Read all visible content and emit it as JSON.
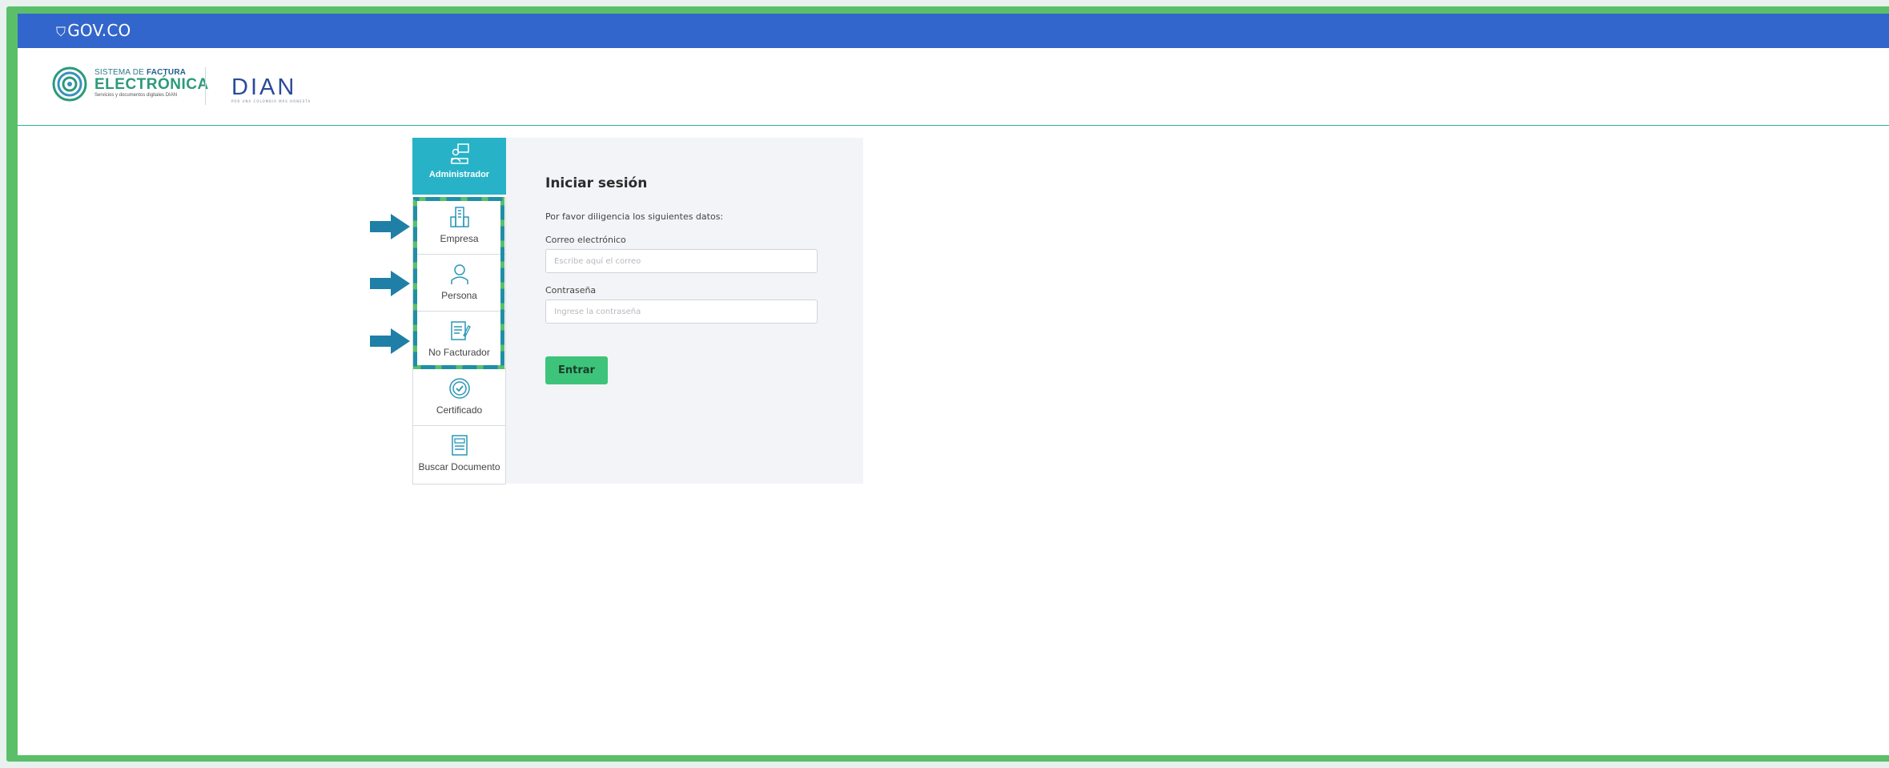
{
  "header": {
    "gov_label": "GOV.CO"
  },
  "brand": {
    "sfe_line1_a": "SISTEMA DE ",
    "sfe_line1_b": "FACTURA",
    "sfe_line2": "ELECTRÓNICA",
    "sfe_line3": "Servicios y documentos digitales DIAN",
    "dian_word": "DIAN",
    "dian_sub": "POR UNA COLOMBIA MÁS HONESTA"
  },
  "sidebar": {
    "items": [
      {
        "label": "Administrador",
        "icon": "admin-icon",
        "active": true
      },
      {
        "label": "Empresa",
        "icon": "building-icon",
        "active": false
      },
      {
        "label": "Persona",
        "icon": "person-icon",
        "active": false
      },
      {
        "label": "No Facturador",
        "icon": "document-edit-icon",
        "active": false
      },
      {
        "label": "Certificado",
        "icon": "certificate-icon",
        "active": false
      },
      {
        "label": "Buscar Documento",
        "icon": "search-document-icon",
        "active": false
      }
    ]
  },
  "login": {
    "title": "Iniciar sesión",
    "instruction": "Por favor diligencia los siguientes datos:",
    "email_label": "Correo electrónico",
    "email_placeholder": "Escribe aquí el correo",
    "password_label": "Contraseña",
    "password_placeholder": "Ingrese la contraseña",
    "submit_label": "Entrar"
  },
  "colors": {
    "frame_green": "#5bbf6a",
    "gov_blue": "#3366cc",
    "active_tab": "#27b2c7",
    "button_green": "#3ec47a",
    "arrow_blue": "#1f7fa6"
  }
}
